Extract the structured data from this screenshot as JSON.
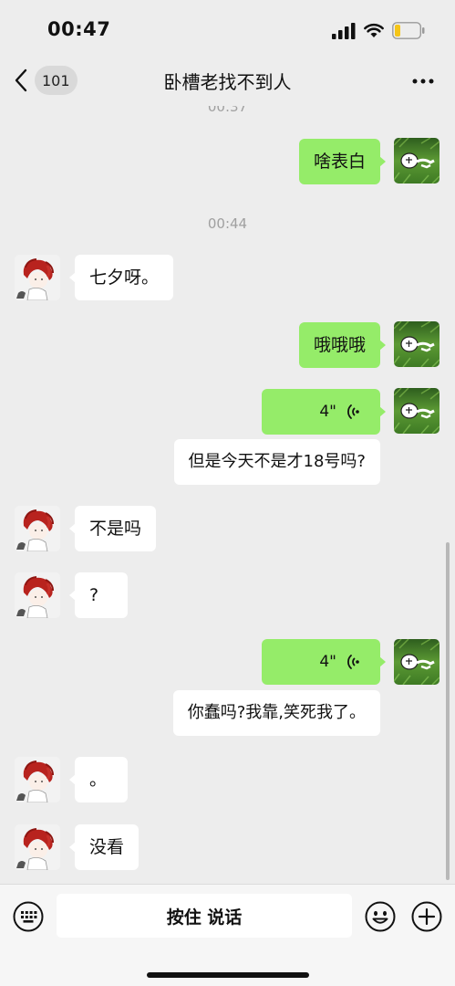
{
  "status_bar": {
    "time": "00:47"
  },
  "nav": {
    "back_count": "101",
    "title": "卧槽老找不到人"
  },
  "messages": [
    {
      "type": "timestamp",
      "text": "00:37"
    },
    {
      "type": "text",
      "side": "right",
      "text": "啥表白"
    },
    {
      "type": "timestamp",
      "text": "00:44"
    },
    {
      "type": "text",
      "side": "left",
      "text": "七夕呀。"
    },
    {
      "type": "text",
      "side": "right",
      "text": "哦哦哦"
    },
    {
      "type": "voice",
      "side": "right",
      "duration": "4\""
    },
    {
      "type": "transcript",
      "side": "right",
      "text": "但是今天不是才18号吗?"
    },
    {
      "type": "text",
      "side": "left",
      "text": "不是吗"
    },
    {
      "type": "text",
      "side": "left",
      "text": "?"
    },
    {
      "type": "voice",
      "side": "right",
      "duration": "4\""
    },
    {
      "type": "transcript",
      "side": "right",
      "text": "你蠢吗?我靠,笑死我了。"
    },
    {
      "type": "text",
      "side": "left",
      "text": "。"
    },
    {
      "type": "text",
      "side": "left",
      "text": "没看"
    }
  ],
  "input_bar": {
    "hold_to_talk_label": "按住 说话"
  },
  "colors": {
    "background": "#EDEDED",
    "self_bubble": "#95EC69",
    "other_bubble": "#FFFFFF",
    "battery_level": "#F5C518"
  },
  "icons": [
    "back-icon",
    "more-icon",
    "voice-wave-icon",
    "keyboard-icon",
    "emoji-icon",
    "plus-icon",
    "signal-icon",
    "wifi-icon",
    "battery-icon"
  ]
}
